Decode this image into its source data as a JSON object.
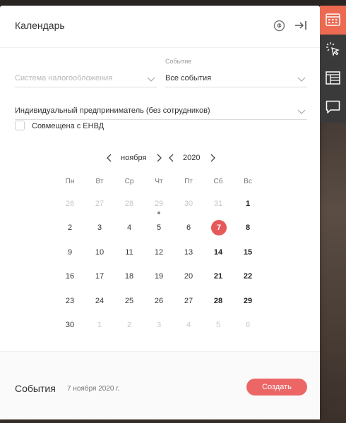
{
  "panel": {
    "title": "Календарь"
  },
  "filters": {
    "tax_system": {
      "placeholder": "Система налогообложения",
      "value": ""
    },
    "event": {
      "label": "Событие",
      "value": "Все события"
    },
    "entity": {
      "value": "Индивидуальный предприниматель (без сотрудников)"
    },
    "envd": {
      "label": "Совмещена с ЕНВД",
      "checked": false
    }
  },
  "calendar": {
    "month": "ноября",
    "year": "2020",
    "weekdays": [
      "Пн",
      "Вт",
      "Ср",
      "Чт",
      "Пт",
      "Сб",
      "Вс"
    ],
    "weeks": [
      [
        "26",
        "27",
        "28",
        "29",
        "30",
        "31",
        "1"
      ],
      [
        "2",
        "3",
        "4",
        "5",
        "6",
        "7",
        "8"
      ],
      [
        "9",
        "10",
        "11",
        "12",
        "13",
        "14",
        "15"
      ],
      [
        "16",
        "17",
        "18",
        "19",
        "20",
        "21",
        "22"
      ],
      [
        "23",
        "24",
        "25",
        "26",
        "27",
        "28",
        "29"
      ],
      [
        "30",
        "1",
        "2",
        "3",
        "4",
        "5",
        "6"
      ]
    ],
    "selected_day": "7"
  },
  "footer": {
    "title": "События",
    "date": "7 ноября 2020 г.",
    "create_label": "Создать"
  },
  "sidebar": {
    "items": [
      {
        "icon": "calendar-icon",
        "active": true
      },
      {
        "icon": "cursor-click-icon",
        "active": false
      },
      {
        "icon": "schedule-icon",
        "active": false
      },
      {
        "icon": "chat-icon",
        "active": false
      }
    ]
  },
  "colors": {
    "accent": "#ec6666",
    "sidebar_active": "#ec6a52",
    "sidebar_bg": "#3a3a3a"
  }
}
